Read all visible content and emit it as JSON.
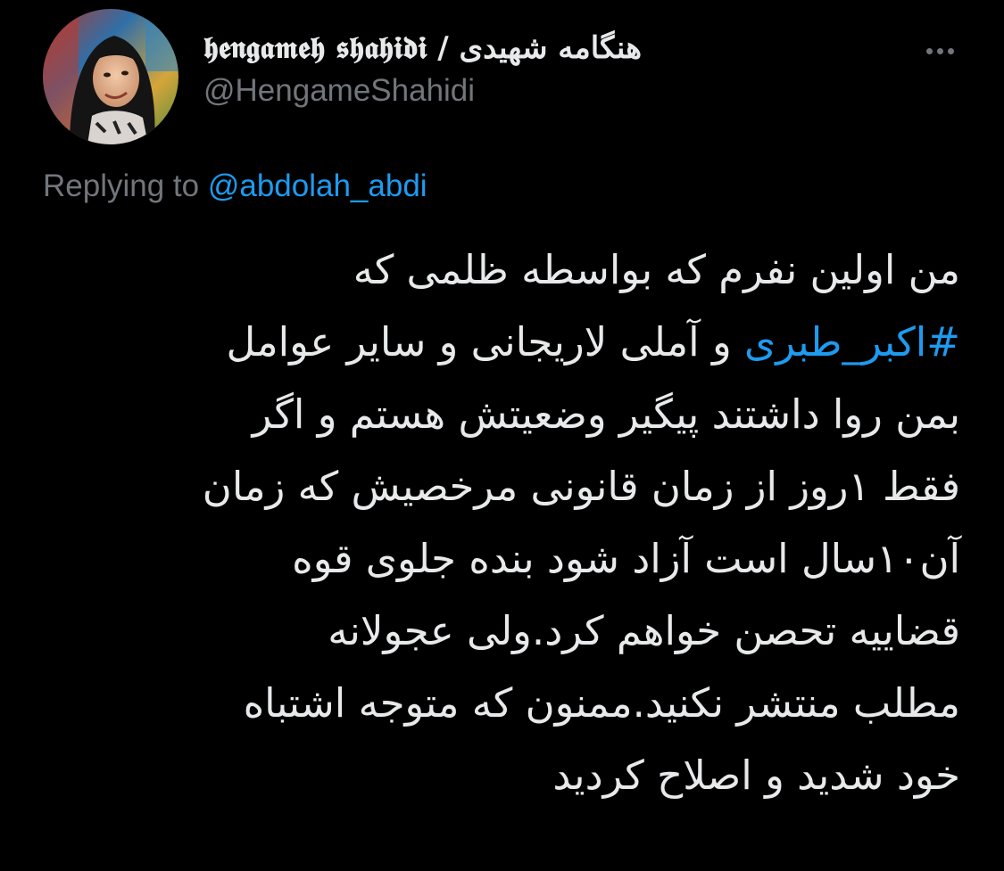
{
  "tweet": {
    "author": {
      "display_name": "𝖍𝖊𝖓𝖌𝖆𝖒𝖊𝖍 𝖘𝖍𝖆𝖍𝖎𝖉𝖎 / هنگامه شهیدی",
      "handle": "@HengameShahidi",
      "avatar_icon": "profile-photo"
    },
    "more_icon": "more-horizontal-icon",
    "reply": {
      "prefix": "Replying to ",
      "mention": "@abdolah_abdi"
    },
    "body": {
      "line1": "من اولین نفرم که بواسطه ظلمی که",
      "line2_hashtag": "#اکبر_طبری",
      "line2_rest": " و آملی لاریجانی و سایر عوامل",
      "line3": "بمن روا داشتند پیگیر وضعیتش هستم و اگر",
      "line4": "فقط ۱روز از زمان قانونی مرخصیش که زمان",
      "line5": "آن۱۰سال است آزاد شود بنده جلوی قوه",
      "line6": "قضاییه تحصن خواهم کرد.ولی عجولانه",
      "line7": "مطلب منتشر نکنید.ممنون که متوجه اشتباه",
      "line8": "خود شدید و اصلاح کردید"
    }
  },
  "colors": {
    "background": "#000000",
    "text_primary": "#e7e9ea",
    "text_secondary": "#71767b",
    "link": "#1d9bf0"
  }
}
